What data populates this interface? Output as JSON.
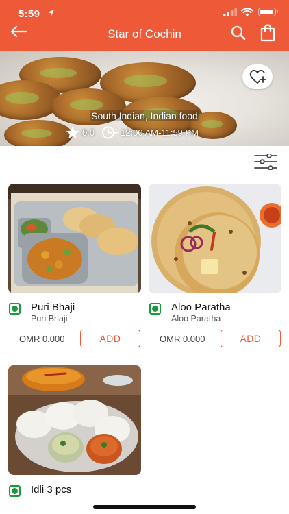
{
  "status_bar": {
    "time": "5:59"
  },
  "header": {
    "title": "Star of Cochin",
    "accent": "#ee5a38",
    "icons": [
      "arrow-left-icon",
      "search-icon",
      "shopping-bag-icon"
    ]
  },
  "restaurant": {
    "cuisine": "South Indian, Indian food",
    "rating": "0.0",
    "hours": "12:00 AM-11:59 PM",
    "favorite_icon": "heart-plus-icon"
  },
  "filter_icon": "sliders-icon",
  "dishes": [
    {
      "name": "Puri Bhaji",
      "subtitle": "Puri Bhaji",
      "price": "OMR 0.000",
      "add_label": "ADD",
      "veg": true
    },
    {
      "name": "Aloo Paratha",
      "subtitle": "Aloo Paratha",
      "price": "OMR 0.000",
      "add_label": "ADD",
      "veg": true
    },
    {
      "name": "Idli 3 pcs",
      "veg": true
    }
  ],
  "colors": {
    "accent": "#ee5a38",
    "veg_green": "#1a9a3a"
  }
}
